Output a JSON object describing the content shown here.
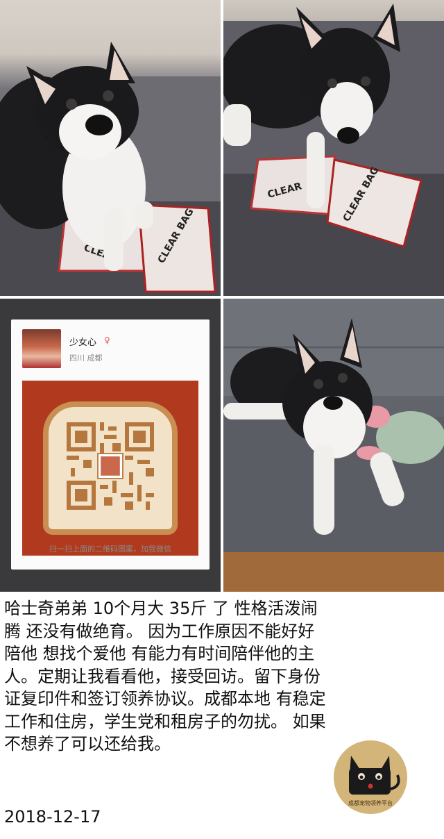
{
  "qr_card": {
    "username": "少女心",
    "location": "四川 成都",
    "caption": "扫一扫上面的二维码图案，加我微信"
  },
  "post": {
    "body": "哈士奇弟弟 10个月大 35斤 了 性格活泼闹腾  还没有做绝育。 因为工作原因不能好好陪他 想找个爱他 有能力有时间陪伴他的主人。定期让我看看他，接受回访。留下身份证复印件和签订领养协议。成都本地 有稳定工作和住房，学生党和租房子的勿扰。 如果不想养了可以还给我。",
    "date": "2018-12-17"
  },
  "logo": {
    "text": "成都宠物领养平台"
  },
  "colors": {
    "qr_background": "#b13a1e",
    "logo_circle": "#d3b57a"
  }
}
